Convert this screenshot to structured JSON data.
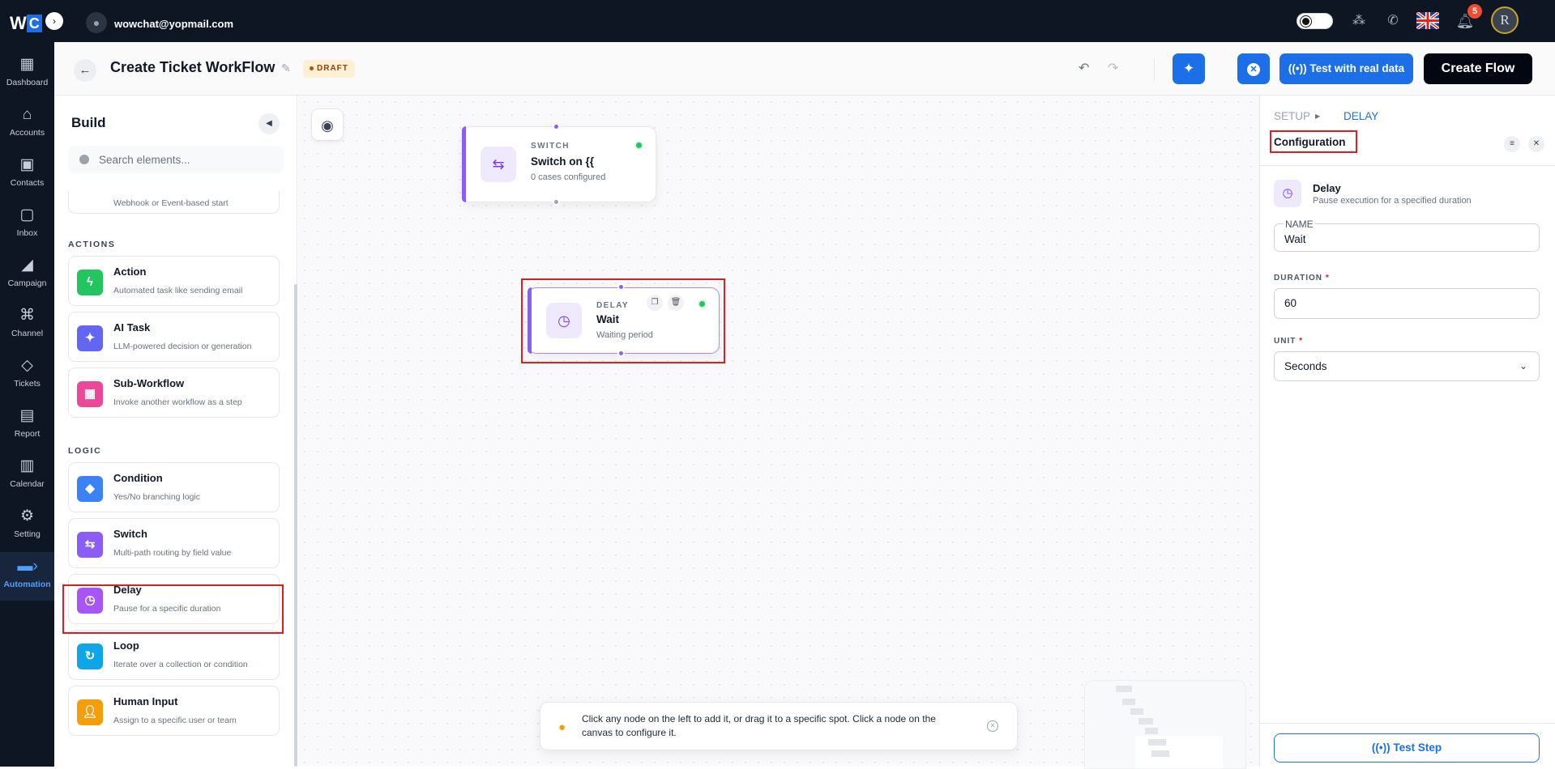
{
  "topbar": {
    "logo_w": "W",
    "logo_c": "C",
    "email": "wowchat@yopmail.com",
    "notification_count": "5",
    "profile_initial": "R"
  },
  "nav": [
    {
      "label": "Dashboard",
      "icon": "dashboard-icon"
    },
    {
      "label": "Accounts",
      "icon": "home-icon"
    },
    {
      "label": "Contacts",
      "icon": "contacts-icon"
    },
    {
      "label": "Inbox",
      "icon": "inbox-icon"
    },
    {
      "label": "Campaign",
      "icon": "megaphone-icon"
    },
    {
      "label": "Channel",
      "icon": "channel-icon"
    },
    {
      "label": "Tickets",
      "icon": "ticket-icon"
    },
    {
      "label": "Report",
      "icon": "report-icon"
    },
    {
      "label": "Calendar",
      "icon": "calendar-icon"
    },
    {
      "label": "Setting",
      "icon": "gear-icon"
    },
    {
      "label": "Automation",
      "icon": "automation-icon",
      "active": true
    }
  ],
  "header": {
    "title": "Create Ticket WorkFlow",
    "status": "DRAFT",
    "test_button": "Test with real data",
    "create_button": "Create Flow"
  },
  "sidebar": {
    "title": "Build",
    "search_placeholder": "Search elements...",
    "trigger_desc": "Webhook or Event-based start",
    "actions_label": "ACTIONS",
    "logic_label": "LOGIC",
    "actions": [
      {
        "name": "Action",
        "desc": "Automated task like sending email",
        "color": "#22c55e",
        "icon": "bolt-icon"
      },
      {
        "name": "AI Task",
        "desc": "LLM-powered decision or generation",
        "color": "#6366f1",
        "icon": "magic-wand-icon"
      },
      {
        "name": "Sub-Workflow",
        "desc": "Invoke another workflow as a step",
        "color": "#ec4899",
        "icon": "grid-icon"
      }
    ],
    "logic": [
      {
        "name": "Condition",
        "desc": "Yes/No branching logic",
        "color": "#3b82f6",
        "icon": "diamond-icon"
      },
      {
        "name": "Switch",
        "desc": "Multi-path routing by field value",
        "color": "#8b5cf6",
        "icon": "switch-icon"
      },
      {
        "name": "Delay",
        "desc": "Pause for a specific duration",
        "color": "#a855f7",
        "icon": "clock-icon"
      },
      {
        "name": "Loop",
        "desc": "Iterate over a collection or condition",
        "color": "#0ea5e9",
        "icon": "loop-icon"
      },
      {
        "name": "Human Input",
        "desc": "Assign to a specific user or team",
        "color": "#f59e0b",
        "icon": "user-icon"
      }
    ]
  },
  "canvas": {
    "switch_node": {
      "type": "SWITCH",
      "name": "Switch on {{",
      "desc": "0 cases configured"
    },
    "delay_node": {
      "type": "DELAY",
      "name": "Wait",
      "desc": "Waiting period"
    },
    "hint": "Click any node on the left to add it, or drag it to a specific spot. Click a node on the canvas to configure it."
  },
  "panel": {
    "crumb_setup": "SETUP",
    "crumb_delay": "DELAY",
    "config_title": "Configuration",
    "node_title": "Delay",
    "node_desc": "Pause execution for a specified duration",
    "name_label": "NAME",
    "name_value": "Wait",
    "duration_label": "DURATION",
    "duration_value": "60",
    "unit_label": "UNIT",
    "unit_value": "Seconds",
    "test_step": "Test Step"
  },
  "colors": {
    "accent": "#1d6fe8",
    "dark": "#0f1623",
    "node_purple": "#8b5cf6",
    "highlight": "#e11d21"
  }
}
